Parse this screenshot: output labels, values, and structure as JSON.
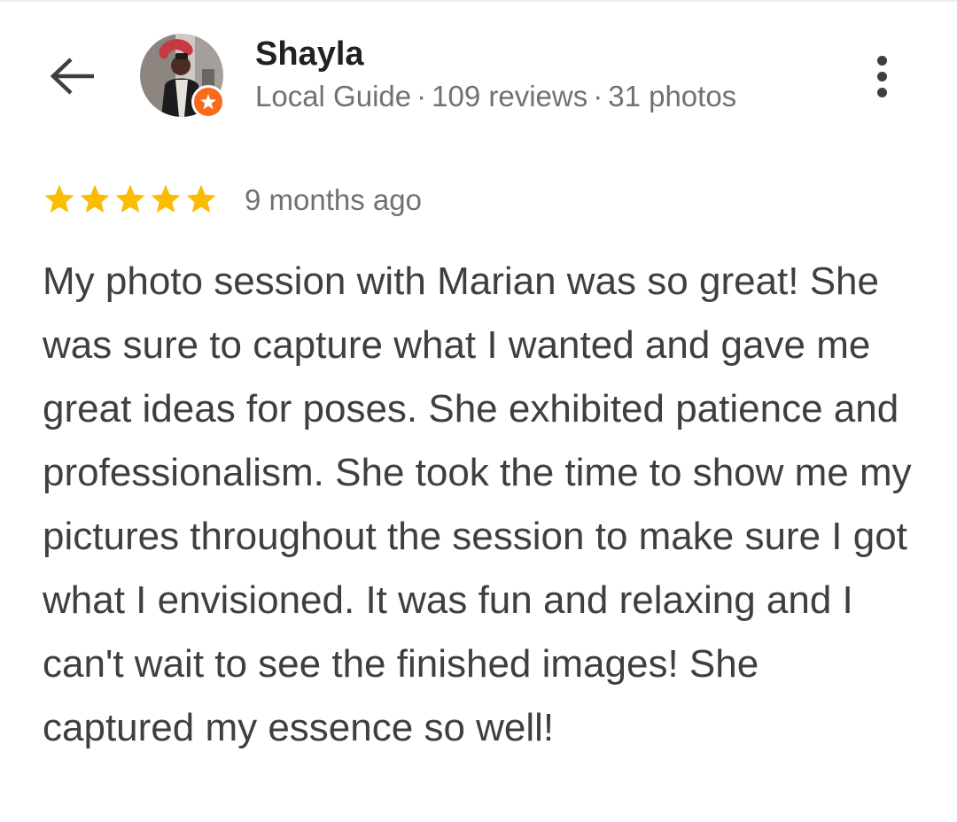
{
  "header": {
    "back_icon": "arrow-left-icon",
    "reviewer_name": "Shayla",
    "badge_icon": "local-guide-star-icon",
    "meta": {
      "level": "Local Guide",
      "separator": "·",
      "reviews": "109 reviews",
      "photos": "31 photos"
    },
    "more_icon": "more-vert-icon"
  },
  "review": {
    "rating": 5,
    "max_rating": 5,
    "star_color": "#fbbc04",
    "time": "9 months ago",
    "text": "My photo session with Marian was so great! She was sure to capture what I wanted and gave me great ideas for poses. She exhibited patience and professionalism. She took the time to show me my pictures throughout the session to make sure I got what I envisioned. It was fun and relaxing and I can't wait to see the finished images! She captured my essence so well!"
  },
  "colors": {
    "name": "#202124",
    "secondary_text": "#6f7175",
    "body_text": "#3c4043",
    "badge": "#f96a1b"
  }
}
